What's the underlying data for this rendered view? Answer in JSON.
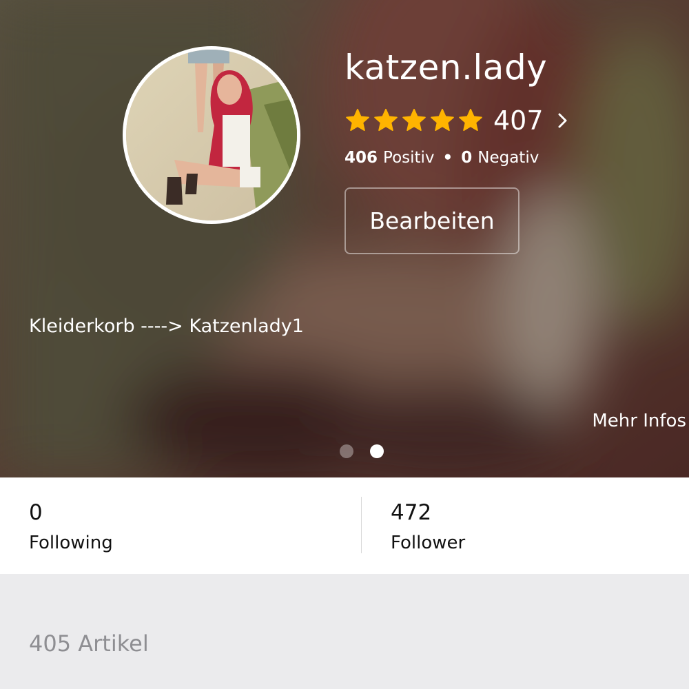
{
  "profile": {
    "username": "katzen.lady",
    "rating": {
      "stars": 5,
      "count": "407",
      "positive_count": "406",
      "positive_label": "Positiv",
      "negative_count": "0",
      "negative_label": "Negativ"
    },
    "edit_label": "Bearbeiten",
    "bio": "Kleiderkorb ---->  Katzenlady1",
    "more_info": "Mehr Infos",
    "pager": {
      "pages": 2,
      "current": 2
    }
  },
  "stats": {
    "following": {
      "value": "0",
      "label": "Following"
    },
    "follower": {
      "value": "472",
      "label": "Follower"
    }
  },
  "items": {
    "header": "405 Artikel"
  },
  "colors": {
    "star": "#FFB400",
    "accent_text": "#ffffff",
    "muted_text": "#8e8e92",
    "page_bg": "#ebebed"
  },
  "icons": {
    "star": "star-icon",
    "chevron": "chevron-right-icon"
  }
}
